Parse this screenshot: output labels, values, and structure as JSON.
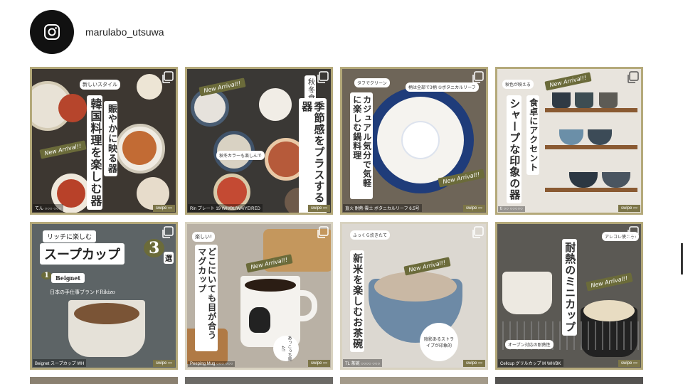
{
  "profile": {
    "username": "marulabo_utsuwa",
    "avatar_icon": "instagram-icon"
  },
  "posts": [
    {
      "title_vertical": "賑やかに映る器",
      "subtitle_vertical": "韓国料理を楽しむ器",
      "kicker": "新しいスタイル",
      "badge": "New Arrival!!",
      "caption": "てん ○○○ ○○○",
      "swipe": "swipe ›››"
    },
    {
      "title_vertical": "季節感をプラスする器",
      "kicker": "秋冬食卓",
      "badge": "New Arrival!!",
      "note": "秋冬カラーも楽しんで",
      "caption": "Rin プレート 19 WH/BL/WA/YE/RED",
      "swipe": "swipe ›››"
    },
    {
      "title_vertical": "カジュアル気分で気軽に楽しむ鍋料理",
      "kicker": "タフでクリーン",
      "note": "柄は全部で3柄 ①ボタニカルリーフ",
      "badge": "New Arrival!!",
      "caption": "直火 耐熱 雲土 ボタニカルリーフ 6.5号",
      "swipe": "swipe ›››"
    },
    {
      "title_vertical": "食卓にアクセント",
      "subtitle_vertical": "シャープな印象の器",
      "kicker": "秋色が映える",
      "badge": "New Arrival!!",
      "caption": "ti ○○ ○○○○○",
      "swipe": "swipe ›››"
    },
    {
      "kicker": "リッチに楽しむ",
      "title": "スープカップ",
      "title_suffix": "3",
      "title_end": "選",
      "item_name": "Beignet",
      "item_number": "1",
      "desc": "日本の手仕事ブランドRikizo",
      "caption": "Beignet スープカップ WH",
      "swipe": "swipe ›››"
    },
    {
      "kicker": "楽しい!",
      "title_vertical": "どこにいても目が合うマグカップ",
      "badge": "New Arrival!!",
      "note": "あっこっち見た!",
      "caption": "Peeping Mug ○○○ ○○○",
      "swipe": "swipe ›››"
    },
    {
      "kicker": "ふっくら炊きたて",
      "title_vertical": "新米を楽しむお茶碗",
      "badge": "New Arrival!!",
      "note": "陰影あるストライプが印象的",
      "caption": "TL 茶碗 ○○○○ ○○○",
      "swipe": "swipe ›››"
    },
    {
      "kicker": "アレコレ使える!",
      "title_vertical": "耐熱のミニカップ",
      "badge": "New Arrival!!",
      "note": "オーブン対応の耐熱性",
      "caption": "Cellcup グリルカップ M WH/BK",
      "swipe": "swipe ›››"
    }
  ],
  "colors": {
    "gold_border": "#b4a97a",
    "swipe_bg": "#7c7548",
    "badge_bg": "#6b6b3a",
    "avatar_bg": "#111111"
  }
}
